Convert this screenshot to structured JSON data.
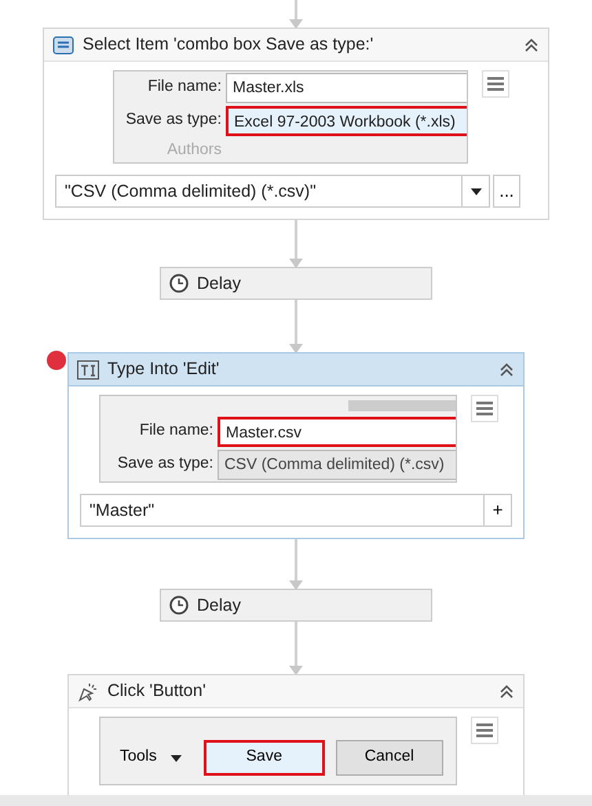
{
  "activities": [
    {
      "kind": "select",
      "title": "Select Item 'combo box  Save as type:'",
      "selected": false,
      "breakpoint": false,
      "preview": {
        "rows": [
          {
            "label": "File name:",
            "value": "Master.xls",
            "kind": "textbox",
            "highlighted": false
          },
          {
            "label": "Save as type:",
            "value": "Excel 97-2003 Workbook (*.xls)",
            "kind": "combobox",
            "highlighted": true
          }
        ],
        "faded_label": "Authors"
      },
      "input": {
        "value": "\"CSV (Comma delimited) (*.csv)\"",
        "dropdown": true,
        "button": "..."
      }
    },
    {
      "kind": "delay",
      "title": "Delay"
    },
    {
      "kind": "type",
      "title": "Type Into 'Edit'",
      "selected": true,
      "breakpoint": true,
      "preview": {
        "top_strip": true,
        "rows": [
          {
            "label": "File name:",
            "value": "Master.csv",
            "kind": "textbox",
            "highlighted": true
          },
          {
            "label": "Save as type:",
            "value": "CSV (Comma delimited) (*.csv)",
            "kind": "readonly",
            "highlighted": false
          }
        ]
      },
      "input": {
        "value": "\"Master\"",
        "dropdown": false,
        "button": "+"
      }
    },
    {
      "kind": "delay",
      "title": "Delay"
    },
    {
      "kind": "click",
      "title": "Click 'Button'",
      "selected": false,
      "breakpoint": false,
      "preview": {
        "toolbar": [
          {
            "label": "Tools",
            "kind": "menu"
          },
          {
            "label": "Save",
            "kind": "button",
            "highlighted": true
          },
          {
            "label": "Cancel",
            "kind": "button",
            "highlighted": false
          }
        ]
      }
    }
  ]
}
